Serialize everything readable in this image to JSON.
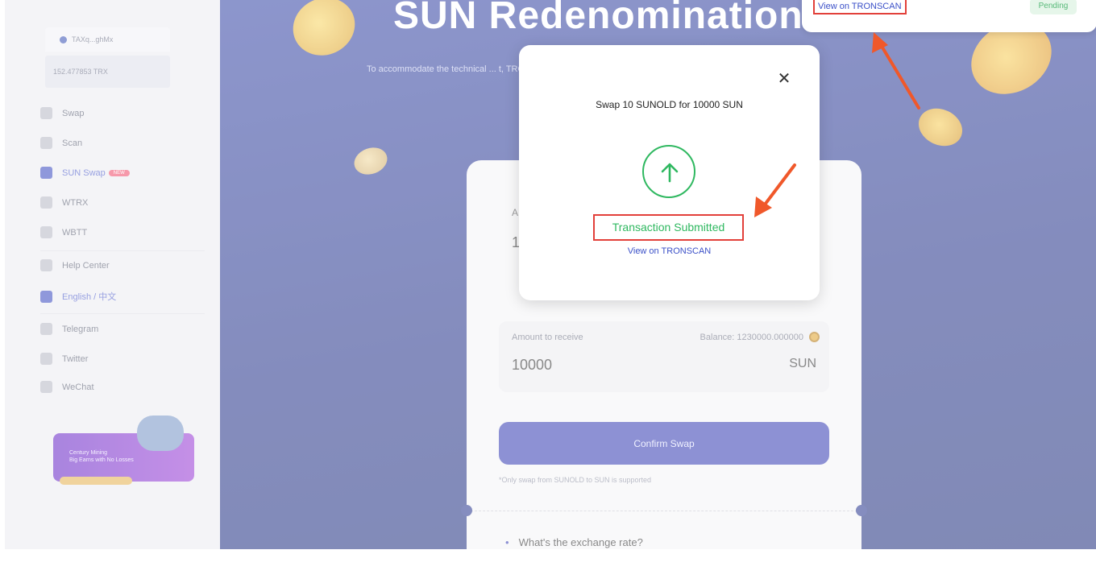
{
  "sidebar": {
    "wallet_address": "TAXq...ghMx",
    "wallet_balance": "152.477853 TRX",
    "items": [
      {
        "label": "Swap",
        "icon": "swap-icon"
      },
      {
        "label": "Scan",
        "icon": "scan-icon"
      },
      {
        "label": "SUN Swap",
        "icon": "sun-swap-icon",
        "badge": "NEW",
        "active": true
      },
      {
        "label": "WTRX",
        "icon": "wtrx-icon"
      },
      {
        "label": "WBTT",
        "icon": "wbtt-icon"
      },
      {
        "label": "Help Center",
        "icon": "help-icon"
      },
      {
        "label": "English / 中文",
        "icon": "globe-icon",
        "active": true
      },
      {
        "label": "Telegram",
        "icon": "telegram-icon"
      },
      {
        "label": "Twitter",
        "icon": "twitter-icon"
      },
      {
        "label": "WeChat",
        "icon": "wechat-icon"
      }
    ],
    "promo": {
      "line1": "Century Mining",
      "line2": "Big Earns with No Losses"
    }
  },
  "hero": {
    "title": "SUN Redenomination",
    "subtitle": "To accommodate the technical ... t, TRON is to support SUN"
  },
  "card": {
    "first_label": "A",
    "first_value": "1",
    "receive": {
      "label": "Amount to receive",
      "balance": "Balance: 1230000.000000",
      "amount": "10000",
      "unit": "SUN"
    },
    "confirm_label": "Confirm Swap",
    "note": "*Only swap from SUNOLD to SUN is supported",
    "faq_question": "What's the exchange rate?"
  },
  "modal": {
    "title": "Swap 10 SUNOLD for 10000 SUN",
    "status": "Transaction Submitted",
    "link": "View on TRONSCAN",
    "close_icon": "close-icon",
    "status_icon": "arrow-up-circle-icon"
  },
  "toast": {
    "link": "View on TRONSCAN",
    "status": "Pending"
  },
  "colors": {
    "brand_blue": "#3b43b6",
    "success_green": "#2fb860",
    "highlight_red": "#e2403a",
    "annotation_orange": "#f0582a"
  }
}
